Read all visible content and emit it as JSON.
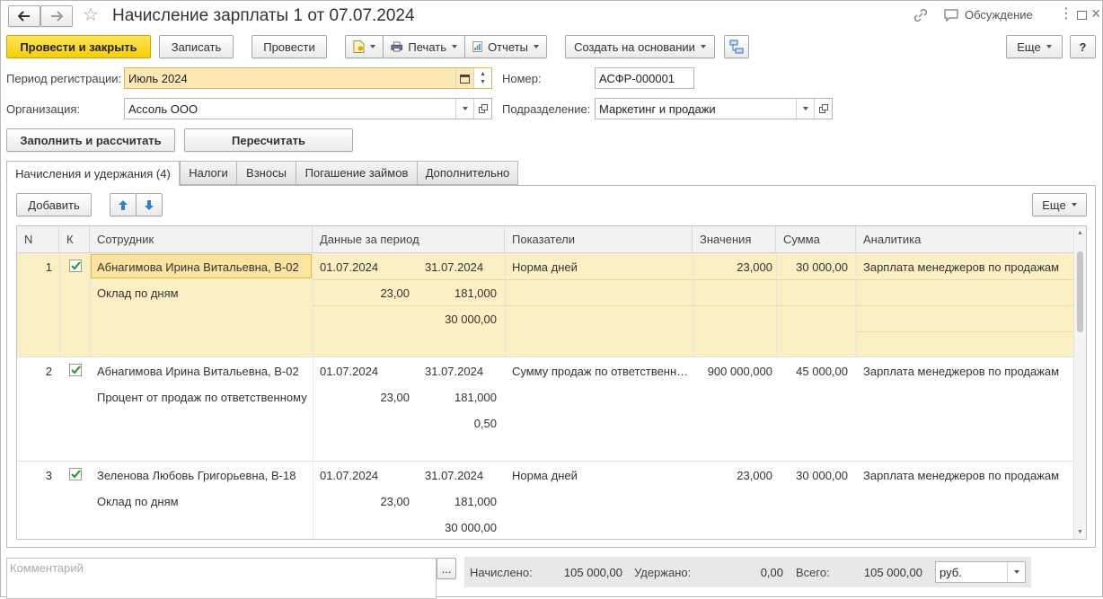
{
  "window": {
    "title": "Начисление зарплаты 1 от 07.07.2024",
    "discuss_label": "Обсуждение"
  },
  "toolbar": {
    "post_close": "Провести и закрыть",
    "save": "Записать",
    "post": "Провести",
    "print": "Печать",
    "reports": "Отчеты",
    "create_based": "Создать на основании",
    "more": "Еще",
    "help": "?"
  },
  "form": {
    "period_label": "Период регистрации:",
    "period_value": "Июль 2024",
    "number_label": "Номер:",
    "number_value": "АСФР-000001",
    "org_label": "Организация:",
    "org_value": "Ассоль ООО",
    "dept_label": "Подразделение:",
    "dept_value": "Маркетинг и продажи"
  },
  "actions": {
    "fill_calc": "Заполнить и рассчитать",
    "recalc": "Пересчитать"
  },
  "tabs": [
    {
      "label": "Начисления и удержания (4)",
      "active": true
    },
    {
      "label": "Налоги"
    },
    {
      "label": "Взносы"
    },
    {
      "label": "Погашение займов"
    },
    {
      "label": "Дополнительно"
    }
  ],
  "table_toolbar": {
    "add": "Добавить",
    "more": "Еще"
  },
  "table": {
    "headers": [
      "N",
      "К",
      "Сотрудник",
      "Данные за период",
      "Показатели",
      "Значения",
      "Сумма",
      "Аналитика"
    ],
    "rows": [
      {
        "n": "1",
        "checked": true,
        "employee": "Абнагимова Ирина Витальевна, В-02",
        "accrual": "Оклад по дням",
        "date_from": "01.07.2024",
        "date_to": "31.07.2024",
        "val1": "23,00",
        "val2": "181,000",
        "val3": "30 000,00",
        "indicator": "Норма дней",
        "value": "23,000",
        "sum": "30 000,00",
        "analytics": "Зарплата менеджеров по продажам"
      },
      {
        "n": "2",
        "checked": true,
        "employee": "Абнагимова Ирина Витальевна, В-02",
        "accrual": "Процент от продаж по ответственному",
        "date_from": "01.07.2024",
        "date_to": "31.07.2024",
        "val1": "23,00",
        "val2": "181,000",
        "val3": "0,50",
        "indicator": "Сумму продаж по ответственн…",
        "value": "900 000,000",
        "sum": "45 000,00",
        "analytics": "Зарплата менеджеров по продажам"
      },
      {
        "n": "3",
        "checked": true,
        "employee": "Зеленова Любовь Григорьевна, В-18",
        "accrual": "Оклад по дням",
        "date_from": "01.07.2024",
        "date_to": "31.07.2024",
        "val1": "23,00",
        "val2": "181,000",
        "val3": "30 000,00",
        "indicator": "Норма дней",
        "value": "23,000",
        "sum": "30 000,00",
        "analytics": "Зарплата менеджеров по продажам"
      }
    ]
  },
  "footer": {
    "comment_placeholder": "Комментарий",
    "comment_btn": "...",
    "accrued_label": "Начислено:",
    "accrued_value": "105 000,00",
    "withheld_label": "Удержано:",
    "withheld_value": "0,00",
    "total_label": "Всего:",
    "total_value": "105 000,00",
    "currency": "руб."
  },
  "colors": {
    "accent": "#f6cf00",
    "selected_row": "#fbefc4",
    "check_green": "#2e9b3a",
    "arrow_blue": "#2f7fd0"
  }
}
